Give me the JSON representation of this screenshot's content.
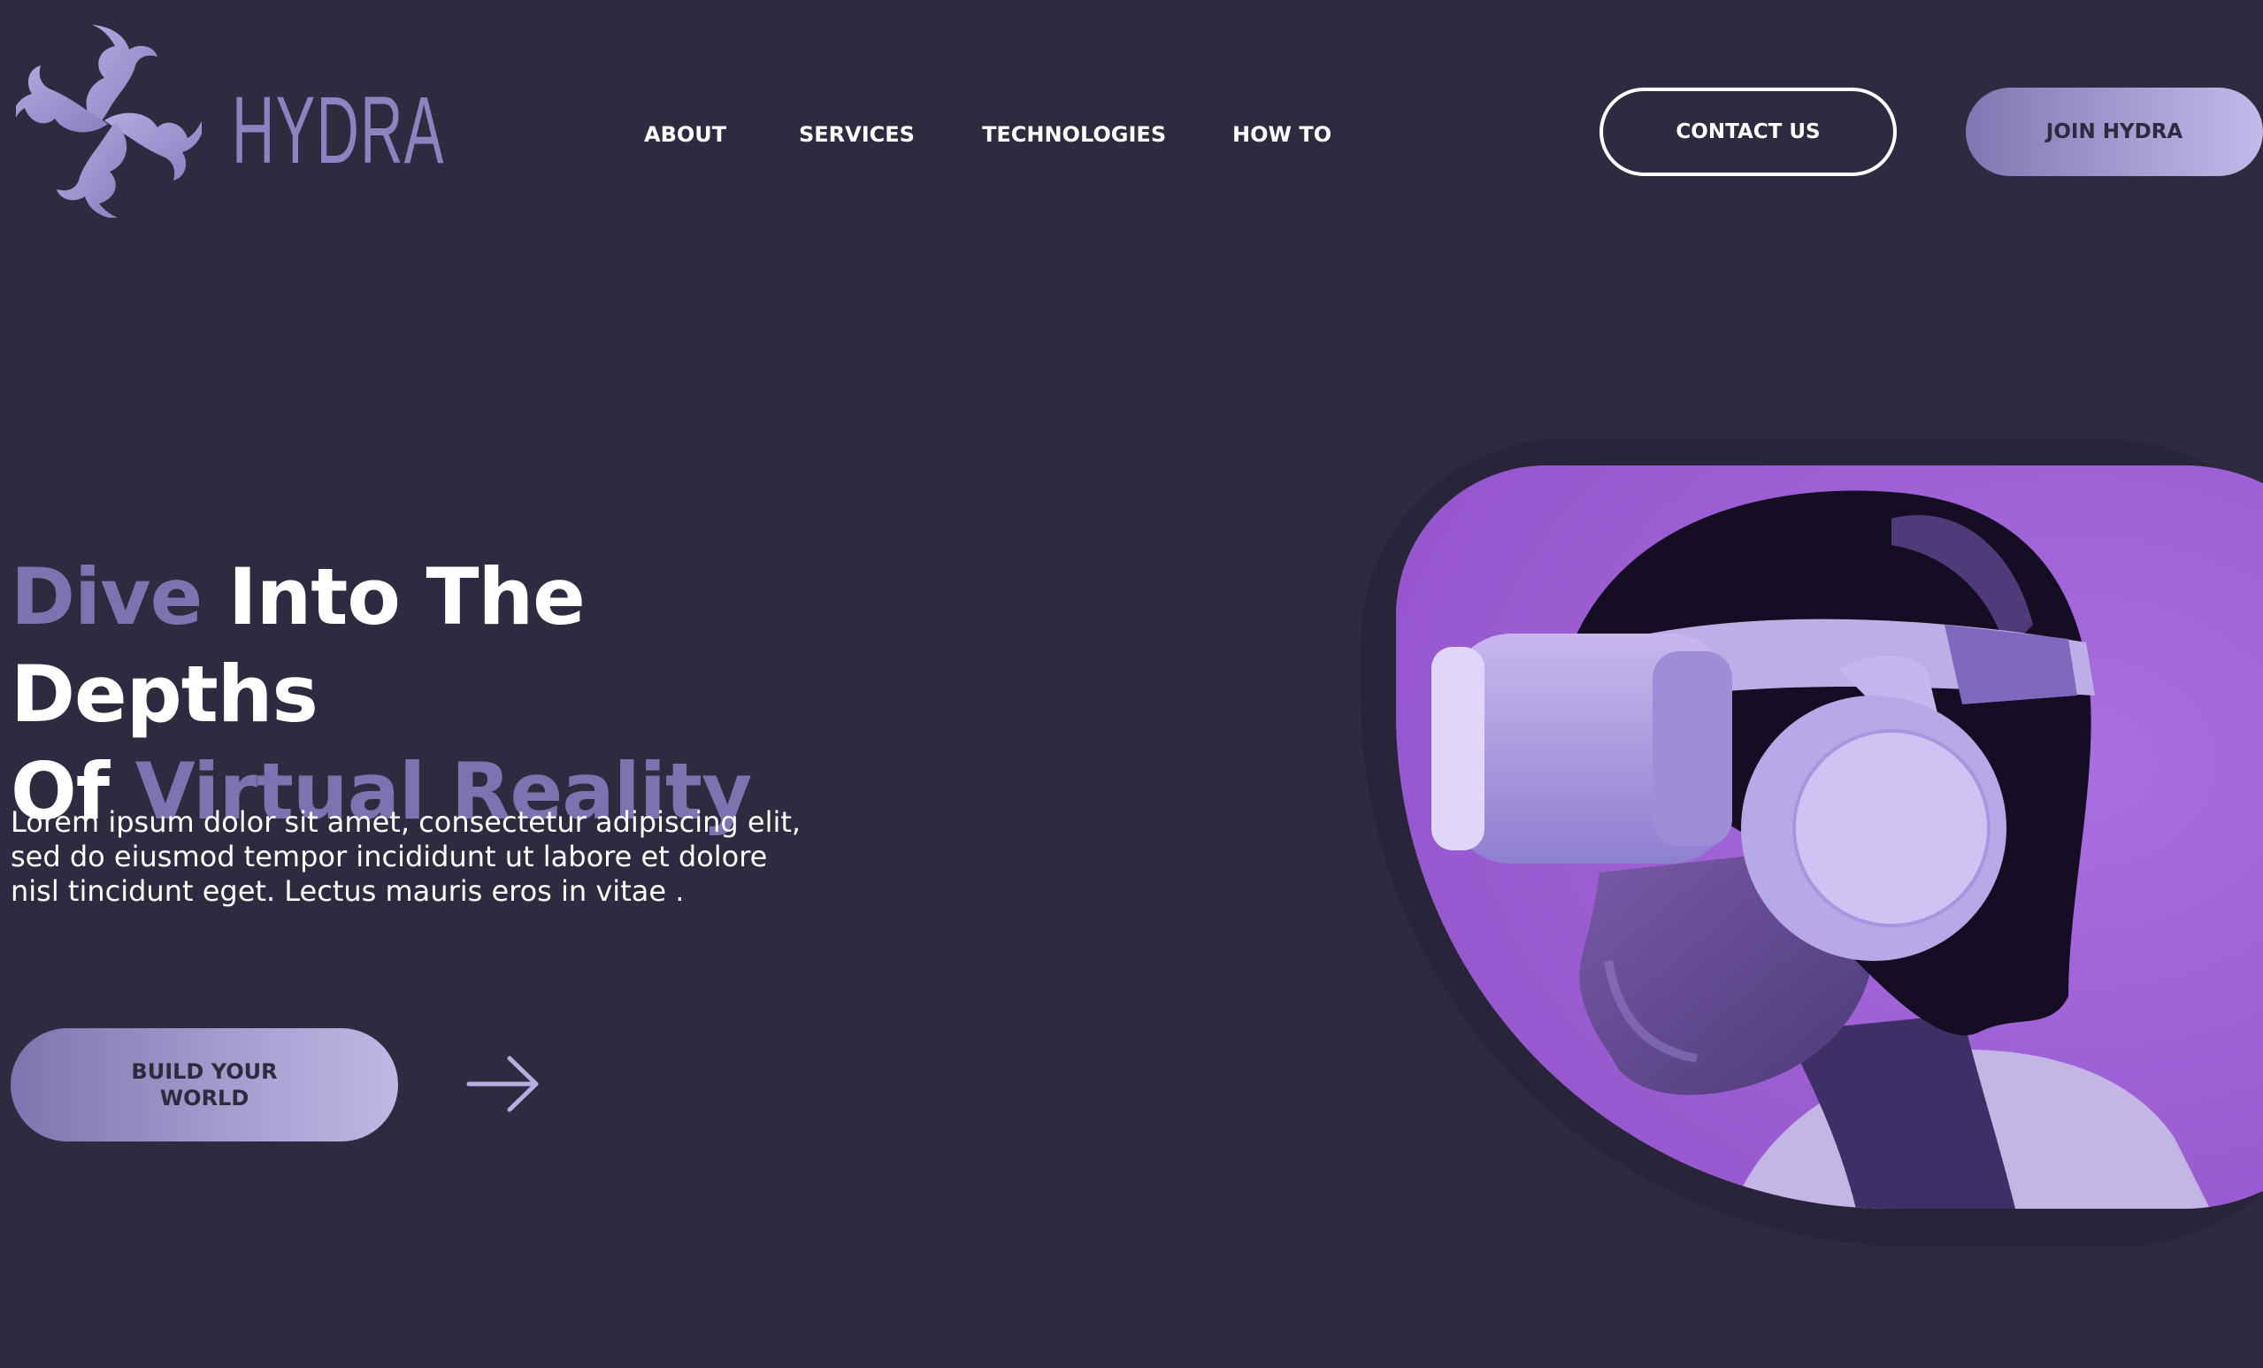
{
  "header": {
    "brand": "HYDRA",
    "nav": [
      {
        "label": "ABOUT"
      },
      {
        "label": "SERVICES"
      },
      {
        "label": "TECHNOLOGIES"
      },
      {
        "label": "HOW TO"
      }
    ],
    "contact_label": "CONTACT US",
    "join_label": "JOIN HYDRA"
  },
  "hero": {
    "headline": {
      "part1": "Dive",
      "part2": " Into The Depths",
      "part3": "Of ",
      "part4": "Virtual Reality"
    },
    "description": "Lorem ipsum dolor sit amet, consectetur adipiscing elit, sed do eiusmod tempor incididunt ut labore et dolore nisl tincidunt eget. Lectus mauris eros in vitae .",
    "cta_label": "BUILD YOUR WORLD"
  },
  "icons": {
    "logo": "hydra-swirl-logo-icon",
    "arrow": "arrow-right-icon"
  },
  "colors": {
    "background": "#2e2b40",
    "accent": "#7d73b0",
    "button_gradient_start": "#7e75b0",
    "button_gradient_end": "#c1baea",
    "photo_background": "#a062d6"
  }
}
